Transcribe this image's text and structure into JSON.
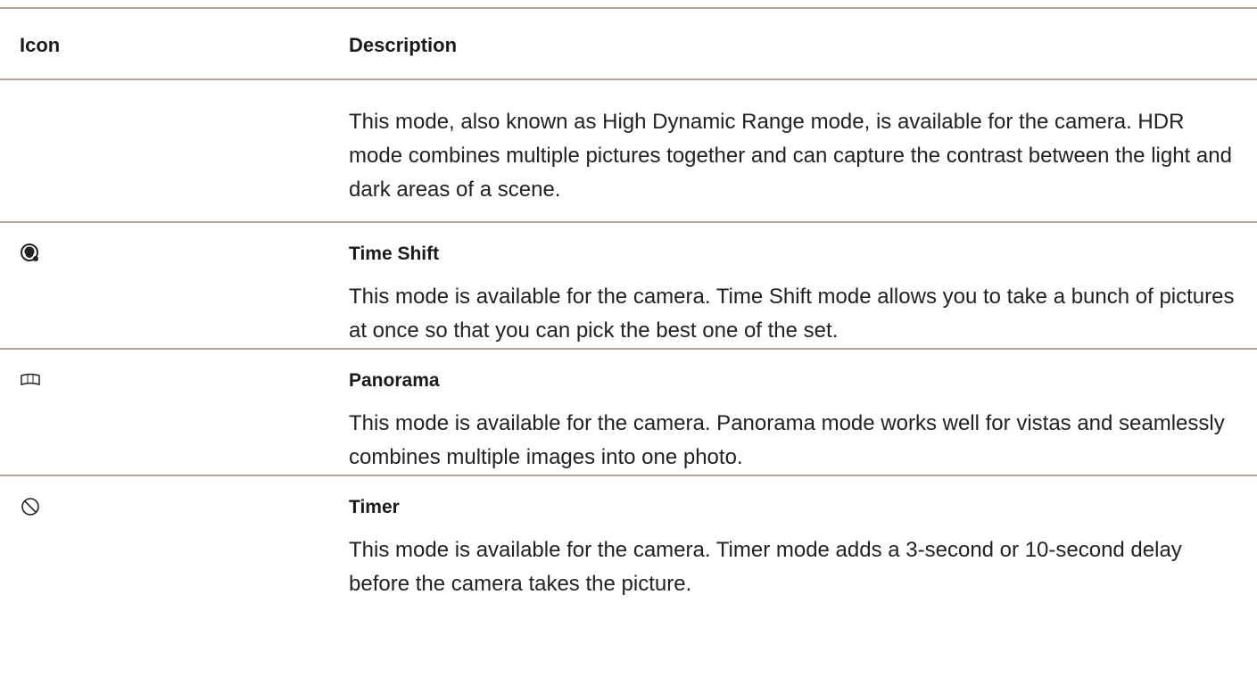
{
  "header": {
    "icon_col": "Icon",
    "desc_col": "Description"
  },
  "rows": [
    {
      "icon": "",
      "title": "",
      "description": "This mode, also known as High Dynamic Range mode, is available for the camera. HDR mode combines multiple pictures together and can capture the contrast between the light and dark areas of a scene."
    },
    {
      "icon": "time-shift-icon",
      "title": "Time Shift",
      "description": "This mode is available for the camera. Time Shift mode allows you to take a bunch of pictures at once so that you can pick the best one of the set."
    },
    {
      "icon": "panorama-icon",
      "title": "Panorama",
      "description": "This mode is available for the camera. Panorama mode works well for vistas and seamlessly combines multiple images into one photo."
    },
    {
      "icon": "timer-icon",
      "title": "Timer",
      "description": "This mode is available for the camera. Timer mode adds a 3-second or 10-second delay before the camera takes the picture."
    }
  ],
  "colors": {
    "rule": "#b8a48e",
    "text": "#1a1a1a"
  }
}
